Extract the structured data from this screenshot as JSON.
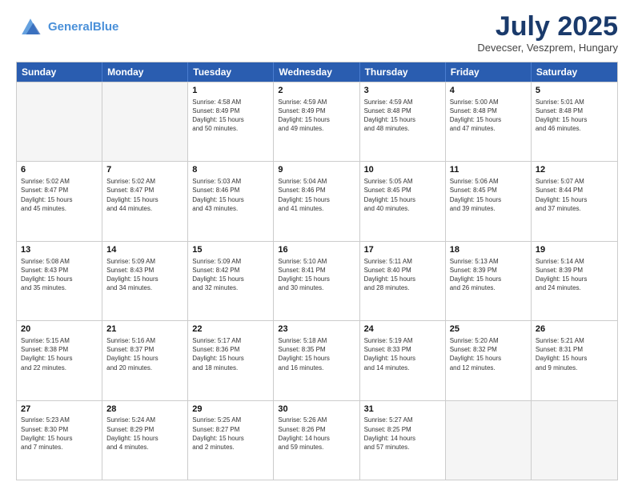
{
  "header": {
    "logo_line1": "General",
    "logo_line2": "Blue",
    "month": "July 2025",
    "location": "Devecser, Veszprem, Hungary"
  },
  "weekdays": [
    "Sunday",
    "Monday",
    "Tuesday",
    "Wednesday",
    "Thursday",
    "Friday",
    "Saturday"
  ],
  "weeks": [
    [
      {
        "day": "",
        "info": ""
      },
      {
        "day": "",
        "info": ""
      },
      {
        "day": "1",
        "info": "Sunrise: 4:58 AM\nSunset: 8:49 PM\nDaylight: 15 hours\nand 50 minutes."
      },
      {
        "day": "2",
        "info": "Sunrise: 4:59 AM\nSunset: 8:49 PM\nDaylight: 15 hours\nand 49 minutes."
      },
      {
        "day": "3",
        "info": "Sunrise: 4:59 AM\nSunset: 8:48 PM\nDaylight: 15 hours\nand 48 minutes."
      },
      {
        "day": "4",
        "info": "Sunrise: 5:00 AM\nSunset: 8:48 PM\nDaylight: 15 hours\nand 47 minutes."
      },
      {
        "day": "5",
        "info": "Sunrise: 5:01 AM\nSunset: 8:48 PM\nDaylight: 15 hours\nand 46 minutes."
      }
    ],
    [
      {
        "day": "6",
        "info": "Sunrise: 5:02 AM\nSunset: 8:47 PM\nDaylight: 15 hours\nand 45 minutes."
      },
      {
        "day": "7",
        "info": "Sunrise: 5:02 AM\nSunset: 8:47 PM\nDaylight: 15 hours\nand 44 minutes."
      },
      {
        "day": "8",
        "info": "Sunrise: 5:03 AM\nSunset: 8:46 PM\nDaylight: 15 hours\nand 43 minutes."
      },
      {
        "day": "9",
        "info": "Sunrise: 5:04 AM\nSunset: 8:46 PM\nDaylight: 15 hours\nand 41 minutes."
      },
      {
        "day": "10",
        "info": "Sunrise: 5:05 AM\nSunset: 8:45 PM\nDaylight: 15 hours\nand 40 minutes."
      },
      {
        "day": "11",
        "info": "Sunrise: 5:06 AM\nSunset: 8:45 PM\nDaylight: 15 hours\nand 39 minutes."
      },
      {
        "day": "12",
        "info": "Sunrise: 5:07 AM\nSunset: 8:44 PM\nDaylight: 15 hours\nand 37 minutes."
      }
    ],
    [
      {
        "day": "13",
        "info": "Sunrise: 5:08 AM\nSunset: 8:43 PM\nDaylight: 15 hours\nand 35 minutes."
      },
      {
        "day": "14",
        "info": "Sunrise: 5:09 AM\nSunset: 8:43 PM\nDaylight: 15 hours\nand 34 minutes."
      },
      {
        "day": "15",
        "info": "Sunrise: 5:09 AM\nSunset: 8:42 PM\nDaylight: 15 hours\nand 32 minutes."
      },
      {
        "day": "16",
        "info": "Sunrise: 5:10 AM\nSunset: 8:41 PM\nDaylight: 15 hours\nand 30 minutes."
      },
      {
        "day": "17",
        "info": "Sunrise: 5:11 AM\nSunset: 8:40 PM\nDaylight: 15 hours\nand 28 minutes."
      },
      {
        "day": "18",
        "info": "Sunrise: 5:13 AM\nSunset: 8:39 PM\nDaylight: 15 hours\nand 26 minutes."
      },
      {
        "day": "19",
        "info": "Sunrise: 5:14 AM\nSunset: 8:39 PM\nDaylight: 15 hours\nand 24 minutes."
      }
    ],
    [
      {
        "day": "20",
        "info": "Sunrise: 5:15 AM\nSunset: 8:38 PM\nDaylight: 15 hours\nand 22 minutes."
      },
      {
        "day": "21",
        "info": "Sunrise: 5:16 AM\nSunset: 8:37 PM\nDaylight: 15 hours\nand 20 minutes."
      },
      {
        "day": "22",
        "info": "Sunrise: 5:17 AM\nSunset: 8:36 PM\nDaylight: 15 hours\nand 18 minutes."
      },
      {
        "day": "23",
        "info": "Sunrise: 5:18 AM\nSunset: 8:35 PM\nDaylight: 15 hours\nand 16 minutes."
      },
      {
        "day": "24",
        "info": "Sunrise: 5:19 AM\nSunset: 8:33 PM\nDaylight: 15 hours\nand 14 minutes."
      },
      {
        "day": "25",
        "info": "Sunrise: 5:20 AM\nSunset: 8:32 PM\nDaylight: 15 hours\nand 12 minutes."
      },
      {
        "day": "26",
        "info": "Sunrise: 5:21 AM\nSunset: 8:31 PM\nDaylight: 15 hours\nand 9 minutes."
      }
    ],
    [
      {
        "day": "27",
        "info": "Sunrise: 5:23 AM\nSunset: 8:30 PM\nDaylight: 15 hours\nand 7 minutes."
      },
      {
        "day": "28",
        "info": "Sunrise: 5:24 AM\nSunset: 8:29 PM\nDaylight: 15 hours\nand 4 minutes."
      },
      {
        "day": "29",
        "info": "Sunrise: 5:25 AM\nSunset: 8:27 PM\nDaylight: 15 hours\nand 2 minutes."
      },
      {
        "day": "30",
        "info": "Sunrise: 5:26 AM\nSunset: 8:26 PM\nDaylight: 14 hours\nand 59 minutes."
      },
      {
        "day": "31",
        "info": "Sunrise: 5:27 AM\nSunset: 8:25 PM\nDaylight: 14 hours\nand 57 minutes."
      },
      {
        "day": "",
        "info": ""
      },
      {
        "day": "",
        "info": ""
      }
    ]
  ]
}
